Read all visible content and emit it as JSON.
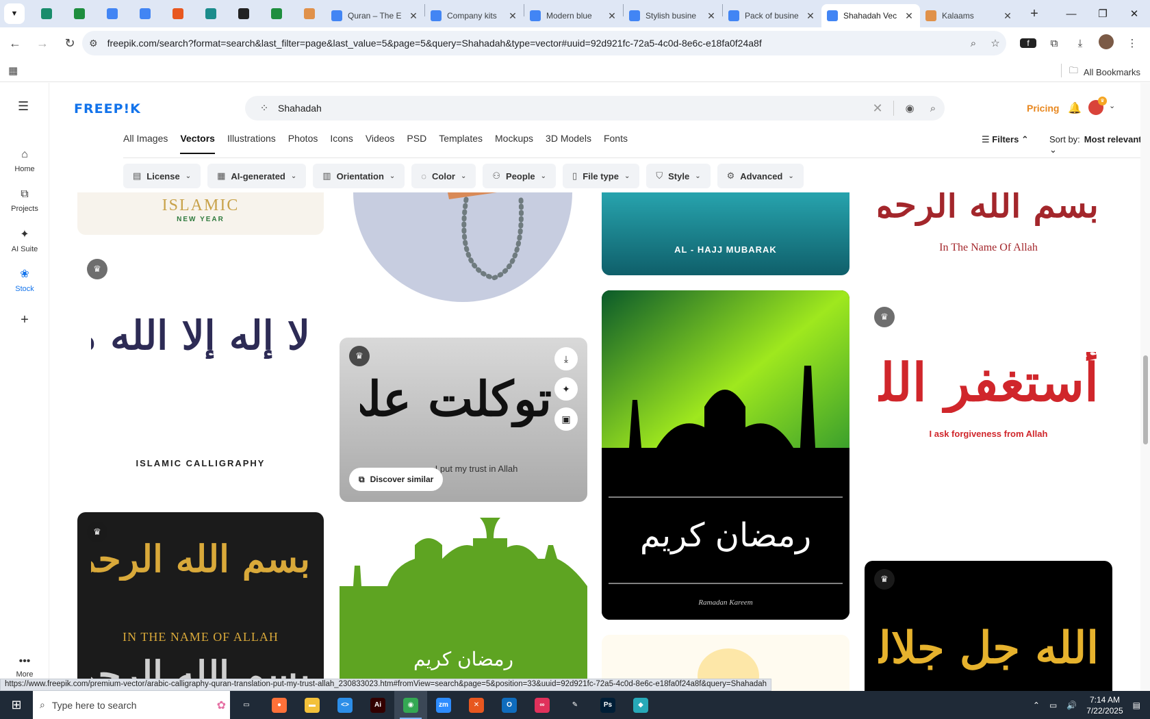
{
  "browser": {
    "pinned_tabs": [
      {
        "name": "vpn-favicon",
        "color": "#1a8c6b"
      },
      {
        "name": "sheets-favicon",
        "color": "#1e8e3e"
      },
      {
        "name": "docs-favicon",
        "color": "#4285f4"
      },
      {
        "name": "docs-favicon-2",
        "color": "#4285f4"
      },
      {
        "name": "app-favicon-orange",
        "color": "#e8571f"
      },
      {
        "name": "app-favicon-teal",
        "color": "#1b8c8c"
      },
      {
        "name": "chatgpt-favicon",
        "color": "#222222"
      },
      {
        "name": "sheets-favicon-2",
        "color": "#1e8e3e"
      },
      {
        "name": "kalaams-favicon",
        "color": "#e0914a"
      }
    ],
    "tabs": [
      {
        "title": "Quran – The E",
        "color": "#4285f4"
      },
      {
        "title": "Company kits",
        "color": "#4285f4"
      },
      {
        "title": "Modern blue",
        "color": "#4285f4"
      },
      {
        "title": "Stylish busine",
        "color": "#4285f4"
      },
      {
        "title": "Pack of busine",
        "color": "#4285f4"
      },
      {
        "title": "Shahadah Vec",
        "color": "#4285f4",
        "active": true
      },
      {
        "title": "Kalaams",
        "color": "#e0914a"
      }
    ],
    "url": "freepik.com/search?format=search&last_filter=page&last_value=5&page=5&query=Shahadah&type=vector#uuid=92d921fc-72a5-4c0d-8e6c-e18fa0f24a8f",
    "all_bookmarks": "All Bookmarks",
    "status_url": "https://www.freepik.com/premium-vector/arabic-calligraphy-quran-translation-put-my-trust-allah_230833023.htm#fromView=search&page=5&position=33&uuid=92d921fc-72a5-4c0d-8e6c-e18fa0f24a8f&query=Shahadah"
  },
  "rail": {
    "items": [
      {
        "label": "Home"
      },
      {
        "label": "Projects"
      },
      {
        "label": "AI Suite"
      },
      {
        "label": "Stock"
      }
    ],
    "more": "More"
  },
  "header": {
    "logo": "FREEP!K",
    "search_value": "Shahadah",
    "pricing": "Pricing"
  },
  "categories": [
    "All Images",
    "Vectors",
    "Illustrations",
    "Photos",
    "Icons",
    "Videos",
    "PSD",
    "Templates",
    "Mockups",
    "3D Models",
    "Fonts"
  ],
  "sort": {
    "filters": "Filters",
    "label": "Sort by:",
    "value": "Most relevant"
  },
  "filters": [
    "License",
    "AI-generated",
    "Orientation",
    "Color",
    "People",
    "File type",
    "Style",
    "Advanced"
  ],
  "cards": {
    "islamic_new_year_a": "ISLAMIC",
    "islamic_new_year_b": "NEW YEAR",
    "hajj": "AL - HAJJ MUBARAK",
    "in_name_red": "In The Name Of Allah",
    "shahadah_caption": "ISLAMIC CALLIGRAPHY",
    "trust_caption": "I put my trust in Allah",
    "discover": "Discover similar",
    "forgiveness": "I ask forgiveness from Allah",
    "in_name_gold": "IN THE NAME OF ALLAH",
    "ramadan_sig": "Ramadan Kareem",
    "arabic_shahadah": "لا إله إلا الله محمد رسول الله",
    "arabic_basmala": "بسم الله الرحمن الرحيم",
    "arabic_trust": "توكلت على الله",
    "arabic_ramadan": "رمضان كريم",
    "arabic_istighfar": "أستغفر الله",
    "arabic_gold2": "الله جل جلاله"
  },
  "taskbar": {
    "search_placeholder": "Type here to search",
    "time": "7:14 AM",
    "date": "7/22/2025",
    "apps": [
      {
        "name": "task-view",
        "color": "#1f2a37",
        "glyph": "▭"
      },
      {
        "name": "firefox",
        "color": "#ff7139",
        "glyph": "●"
      },
      {
        "name": "file-explorer",
        "color": "#f3c13a",
        "glyph": "▬"
      },
      {
        "name": "vscode",
        "color": "#2c8ee8",
        "glyph": "<>"
      },
      {
        "name": "illustrator",
        "color": "#330000",
        "glyph": "Ai"
      },
      {
        "name": "chrome",
        "color": "#34a853",
        "glyph": "◉",
        "active": true
      },
      {
        "name": "zoom",
        "color": "#2d8cff",
        "glyph": "zm"
      },
      {
        "name": "app-orange",
        "color": "#e8571f",
        "glyph": "✕"
      },
      {
        "name": "outlook",
        "color": "#0f6cbd",
        "glyph": "O"
      },
      {
        "name": "creative-cloud",
        "color": "#e0315b",
        "glyph": "∞"
      },
      {
        "name": "pen-tool",
        "color": "#1f2a37",
        "glyph": "✎"
      },
      {
        "name": "photoshop",
        "color": "#001e36",
        "glyph": "Ps"
      },
      {
        "name": "app-teal",
        "color": "#27a9b8",
        "glyph": "◆"
      }
    ]
  }
}
